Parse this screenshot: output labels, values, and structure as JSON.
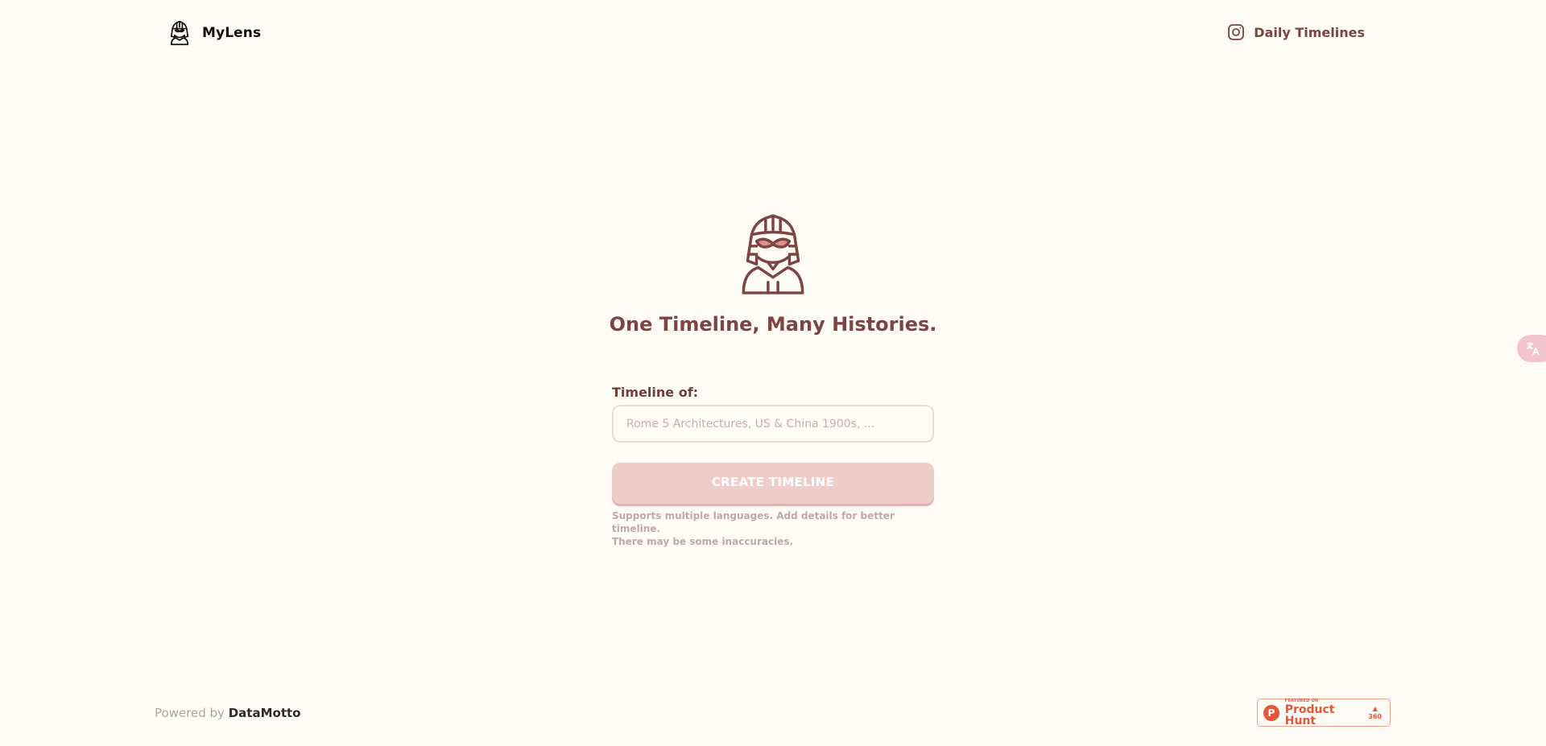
{
  "header": {
    "brand_name": "MyLens",
    "brand_logo_icon": "pharaoh-icon",
    "daily_link_label": "Daily Timelines",
    "daily_link_icon": "instagram-icon"
  },
  "hero": {
    "icon": "pharaoh-with-sunglasses-icon",
    "tagline": "One Timeline, Many Histories."
  },
  "form": {
    "label": "Timeline of:",
    "input_value": "",
    "input_placeholder": "Rome 5 Architectures, US & China 1900s, ...",
    "button_label": "CREATE TIMELINE",
    "hint_line1": "Supports multiple languages. Add details for better timeline.",
    "hint_line2": "There may be some inaccuracies."
  },
  "translate_tab": {
    "icon": "translate-icon"
  },
  "footer": {
    "powered_prefix": "Powered by",
    "powered_brand": "DataMotto"
  },
  "product_hunt": {
    "small_text": "FEATURED ON",
    "name": "Product Hunt",
    "votes": "360",
    "logo_letter": "P"
  },
  "colors": {
    "background": "#fffbf5",
    "accent": "#7a4543",
    "button": "#efcdc9",
    "product_hunt": "#e4573a"
  }
}
